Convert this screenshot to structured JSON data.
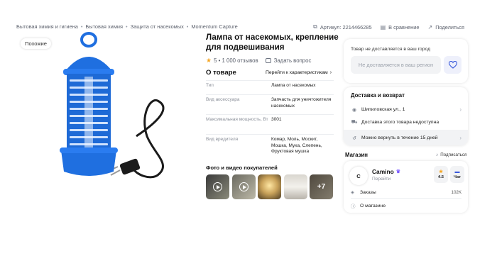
{
  "breadcrumbs": [
    "Бытовая химия и гигиена",
    "Бытовая химия",
    "Защита от насекомых",
    "Momentum Capture"
  ],
  "meta": {
    "article": "Артикул: 2214466285",
    "compare": "В сравнение",
    "share": "Поделиться"
  },
  "gallery": {
    "badge": "Похожие",
    "product_color": "#1f6fe0"
  },
  "product": {
    "title": "Лампа от насекомых, крепление для подвешивания",
    "rating": "5",
    "reviews": "1 000 отзывов",
    "ask": "Задать вопрос"
  },
  "about": {
    "heading": "О товаре",
    "to_chars": "Перейти к характеристикам",
    "specs": [
      {
        "key": "Тип",
        "value": "Лампа от насекомых"
      },
      {
        "key": "Вид аксессуара",
        "value": "Запчасть для уничтожителя насекомых"
      },
      {
        "key": "Максимальная мощность, Вт",
        "value": "3001"
      },
      {
        "key": "Вид вредителя",
        "value": "Комар, Моль, Мoскит, Мошка, Муха, Слепень, Фруктовая мушка"
      }
    ]
  },
  "media": {
    "heading": "Фото и видео покупателей",
    "more": "+7"
  },
  "delivery_notice": {
    "hint": "Товар не доставляется в ваш город",
    "region_button": "Не доставляется в ваш регион"
  },
  "delivery": {
    "heading": "Доставка и возврат",
    "address": "Шипиловская ул., 1",
    "status": "Доставка этого товара недоступна",
    "returns": "Можно вернуть в течение 15 дней"
  },
  "shop": {
    "heading": "Магазин",
    "subscribe": "Подписаться",
    "logo_letter": "C",
    "name": "Camino",
    "go": "Перейти",
    "rating": "4.5",
    "chat": "Чат",
    "orders_label": "Заказы",
    "orders_value": "102K",
    "about": "О магазине"
  },
  "colors": {
    "accent": "#3b5bdb",
    "star": "#f5a623",
    "product_blue": "#1f6fe0"
  }
}
